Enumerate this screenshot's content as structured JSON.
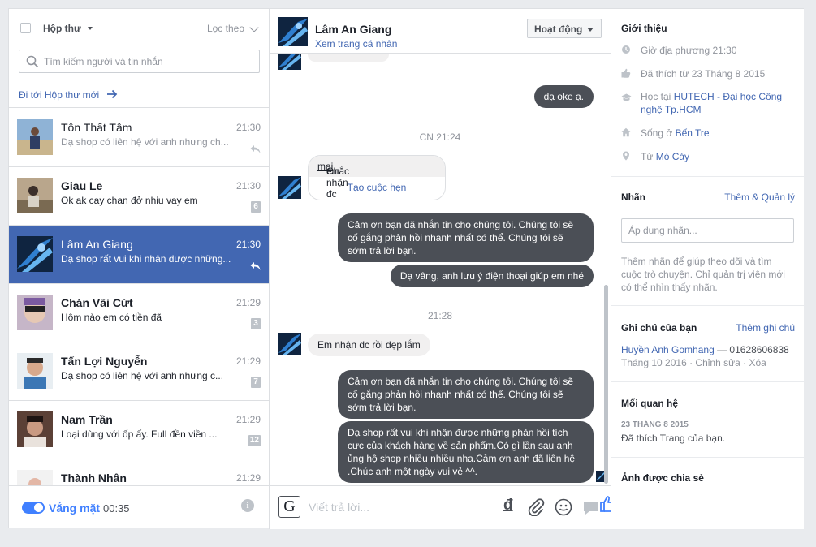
{
  "inbox": {
    "title": "Hộp thư",
    "filter": "Lọc theo",
    "search_placeholder": "Tìm kiếm người và tin nhắn",
    "goto_new": "Đi tới Hộp thư mới"
  },
  "threads": [
    {
      "name": "Tôn Thất Tâm",
      "time": "21:30",
      "preview": "Dạ shop có liên hệ với anh nhưng ch...",
      "badge": "",
      "replied": true,
      "unread": false,
      "selected": false
    },
    {
      "name": "Giau Le",
      "time": "21:30",
      "preview": "Ok ak cay chan đở nhiu vay em",
      "badge": "6",
      "replied": false,
      "unread": true,
      "selected": false
    },
    {
      "name": "Lâm An Giang",
      "time": "21:30",
      "preview": "Dạ shop rất vui khi nhận được những...",
      "badge": "",
      "replied": true,
      "unread": false,
      "selected": true
    },
    {
      "name": "Chán Vãi Cứt",
      "time": "21:29",
      "preview": "Hôm nào em có tiền đã",
      "badge": "3",
      "replied": false,
      "unread": true,
      "selected": false
    },
    {
      "name": "Tấn Lợi Nguyễn",
      "time": "21:29",
      "preview": "Dạ shop có liên hệ với anh nhưng c...",
      "badge": "7",
      "replied": false,
      "unread": true,
      "selected": false
    },
    {
      "name": "Nam Trần",
      "time": "21:29",
      "preview": "Loại dùng với ốp ấy. Full đền viền ...",
      "badge": "12",
      "replied": false,
      "unread": true,
      "selected": false
    },
    {
      "name": "Thành Nhân",
      "time": "21:29",
      "preview": "",
      "badge": "",
      "replied": false,
      "unread": true,
      "selected": false
    }
  ],
  "away": {
    "label": "Vắng mặt",
    "time": "00:35"
  },
  "conversation": {
    "name": "Lâm An Giang",
    "profile_link": "Xem trang cá nhân",
    "status_button": "Hoạt động",
    "messages": {
      "m1": "dạ oke ạ.",
      "stamp1": "CN 21:24",
      "card_text_a": "Chắc ",
      "card_text_u": "mai",
      "card_text_b": " em nhận đc hàng",
      "card_link": "Tạo cuộc hẹn",
      "m3": "Cảm ơn bạn đã nhắn tin cho chúng tôi. Chúng tôi sẽ cố gắng phản hồi nhanh nhất có thể. Chúng tôi sẽ sớm trả lời bạn.",
      "m4": "Dạ vâng, anh lưu ý điện thoại giúp em nhé",
      "stamp2": "21:28",
      "m5": "Em nhận đc rồi đẹp lắm",
      "m6": "Cảm ơn bạn đã nhắn tin cho chúng tôi. Chúng tôi sẽ cố gắng phản hồi nhanh nhất có thể. Chúng tôi sẽ sớm trả lời bạn.",
      "m7": "Dạ shop rất vui khi nhận được những phản hồi tích cực của khách hàng về sản phẩm.Có gì lần sau anh ủng hộ shop nhiều nhiều nha.Cảm ơn anh đã liên hệ .Chúc anh một ngày vui vẻ ^^."
    },
    "composer_placeholder": "Viết trả lời...",
    "currency_icon": "đ"
  },
  "profile": {
    "intro_title": "Giới thiệu",
    "local_time": "Giờ địa phương 21:30",
    "liked_since": "Đã thích từ 23 Tháng 8 2015",
    "study_prefix": "Học tại ",
    "study_link": "HUTECH - Đại học Công nghệ Tp.HCM",
    "live_prefix": "Sống ở ",
    "live_link": "Bến Tre",
    "from_prefix": "Từ ",
    "from_link": "Mỏ Cày",
    "labels_title": "Nhãn",
    "labels_action": "Thêm & Quản lý",
    "labels_placeholder": "Áp dụng nhãn...",
    "labels_hint": "Thêm nhãn để giúp theo dõi và tìm cuộc trò chuyện. Chỉ quản trị viên mới có thể nhìn thấy nhãn.",
    "notes_title": "Ghi chú của bạn",
    "notes_action": "Thêm ghi chú",
    "note_author": "Huyền Anh Gomhang",
    "note_text": " — 01628606838",
    "note_meta": "Tháng 10 2016 · Chỉnh sửa · Xóa",
    "relation_title": "Mối quan hệ",
    "relation_date": "23 THÁNG 8 2015",
    "relation_text": "Đã thích Trang của bạn.",
    "shared_title": "Ảnh được chia sẻ"
  },
  "colors": {
    "accent": "#4267b2",
    "selected_row": "#4267b2",
    "toggle": "#4080ff",
    "outgoing_bubble": "#4b4f56",
    "incoming_bubble": "#f1f0f0"
  }
}
